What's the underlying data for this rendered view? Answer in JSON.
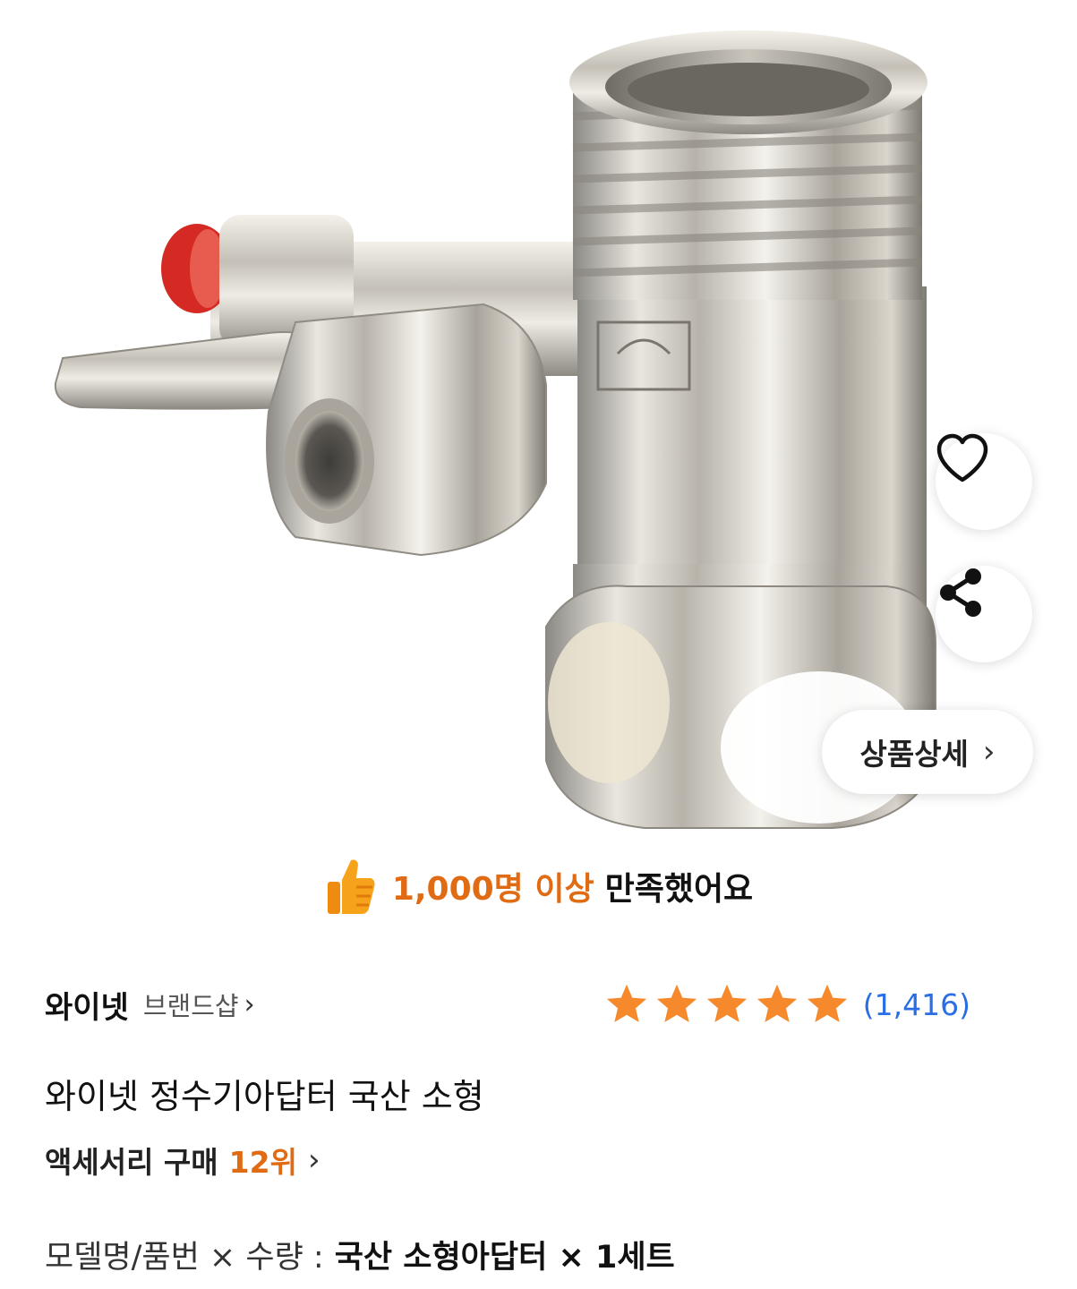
{
  "product_image": {
    "subject": "adapter-valve-icon"
  },
  "actions": {
    "wishlist_icon": "heart-icon",
    "share_icon": "share-icon",
    "detail_label": "상품상세",
    "detail_chevron": "›"
  },
  "satisfaction": {
    "icon": "thumbs-up-icon",
    "highlight": "1,000명 이상",
    "text": "만족했어요",
    "highlight_color": "#e16b12"
  },
  "brand": {
    "name": "와이넷",
    "shop_label": "브랜드샵",
    "chevron": "›"
  },
  "rating": {
    "stars": 5,
    "star_color": "#f5892b",
    "count": "(1,416)",
    "count_color": "#2a6ee5"
  },
  "product": {
    "title": "와이넷 정수기아답터 국산 소형"
  },
  "ranking": {
    "category": "액세서리 구매",
    "rank": "12위",
    "chevron": "›"
  },
  "option": {
    "label": "모델명/품번 × 수량 :",
    "value": "국산 소형아답터 × 1세트"
  }
}
